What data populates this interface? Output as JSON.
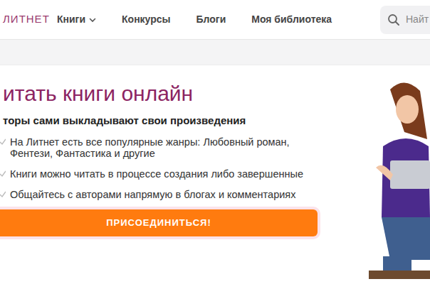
{
  "logo": "ЛИТНЕТ",
  "nav": [
    {
      "label": "Книги",
      "dropdown": true
    },
    {
      "label": "Конкурсы",
      "dropdown": false
    },
    {
      "label": "Блоги",
      "dropdown": false
    },
    {
      "label": "Моя библиотека",
      "dropdown": false
    }
  ],
  "search": {
    "placeholder": "Найт"
  },
  "hero": {
    "title": "итать книги онлайн",
    "subtitle": "торы сами выкладывают свои произведения",
    "features": [
      "На Литнет есть все популярные жанры: Любовный роман, Фентези, Фантастика и другие",
      "Книги можно читать в процессе создания либо завершенные",
      "Общайтесь с авторами напрямую в блогах и комментариях"
    ],
    "button": "ПРИСОЕДИНИТЬСЯ!"
  }
}
